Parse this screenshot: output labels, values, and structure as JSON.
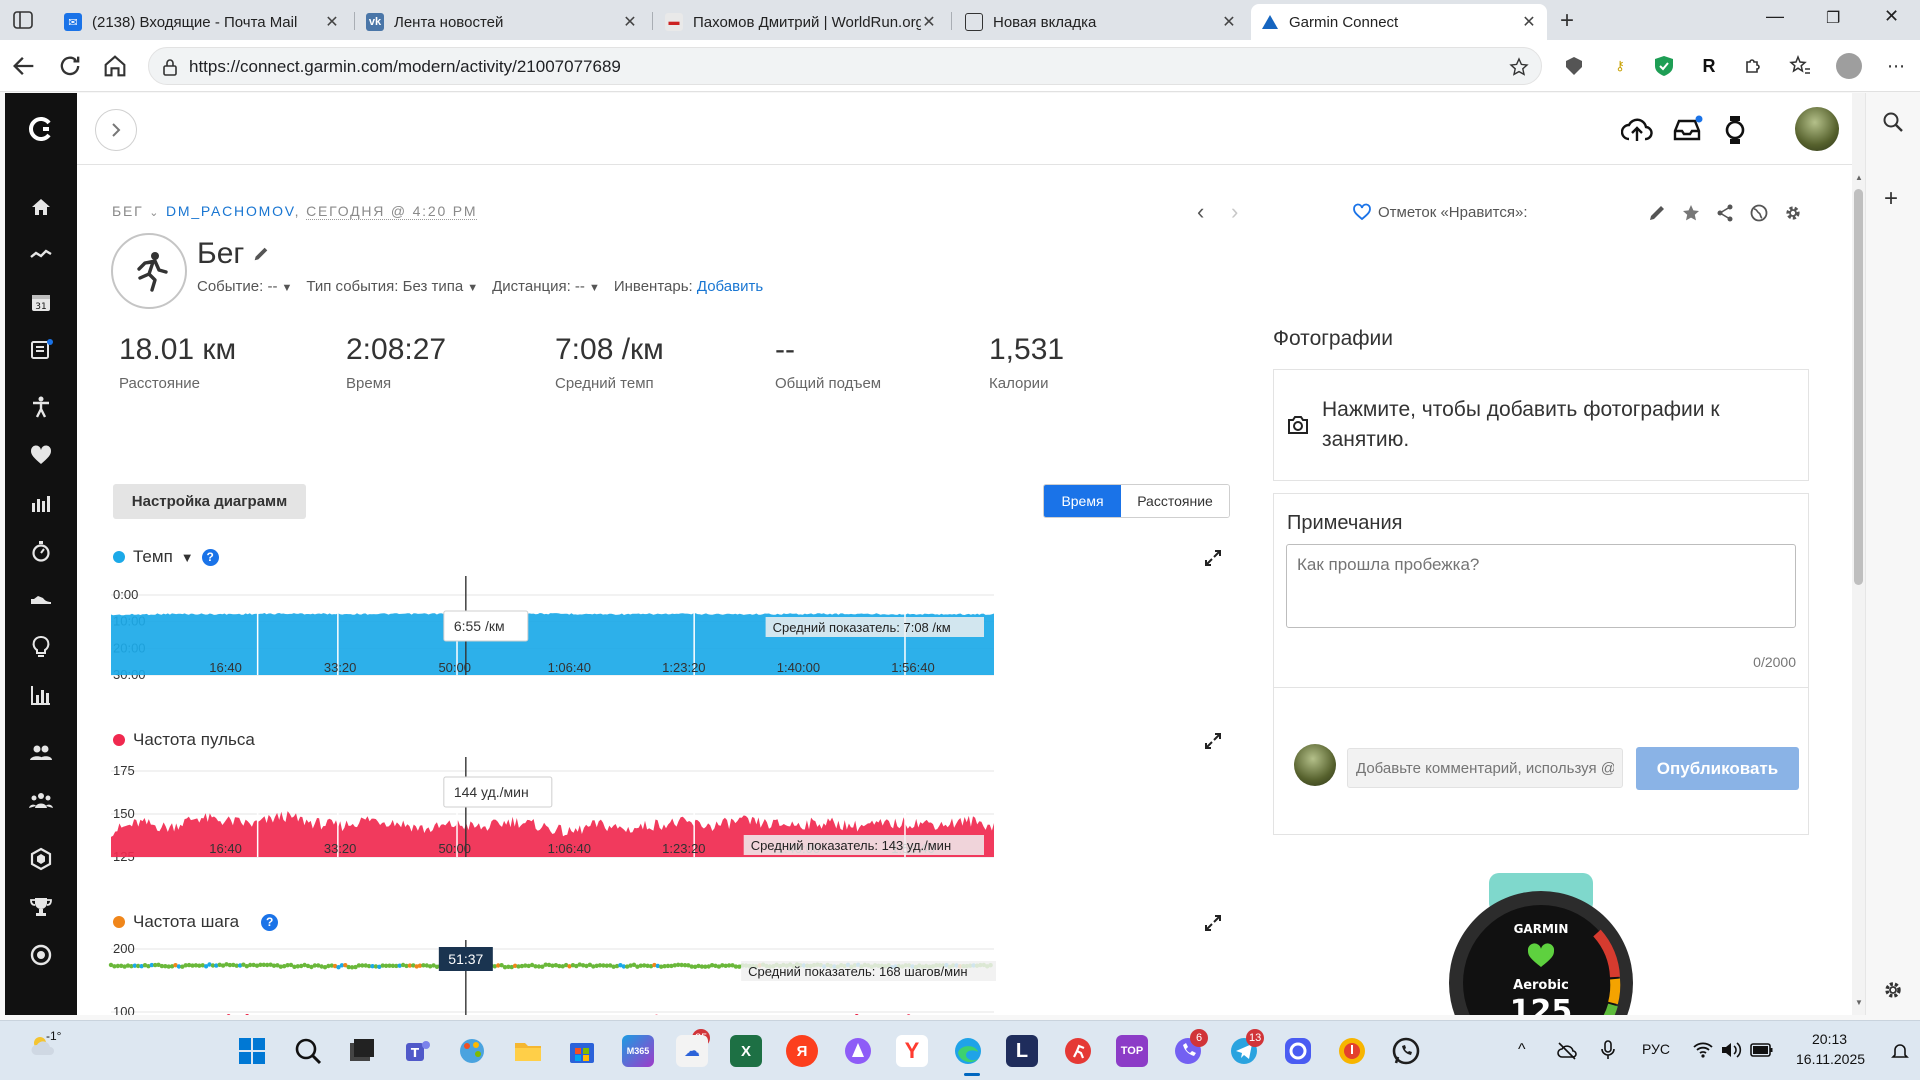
{
  "browser": {
    "tabs": [
      {
        "title": "(2138) Входящие - Почта Mail",
        "active": false
      },
      {
        "title": "Лента новостей",
        "active": false
      },
      {
        "title": "Пахомов Дмитрий | WorldRun.org",
        "active": false
      },
      {
        "title": "Новая вкладка",
        "active": false
      },
      {
        "title": "Garmin Connect",
        "active": true
      }
    ],
    "url": "https://connect.garmin.com/modern/activity/21007077689"
  },
  "activity": {
    "breadcrumb": {
      "sport": "БЕГ",
      "user": "DM_PACHOMOV",
      "date": "СЕГОДНЯ @ 4:20 PM"
    },
    "title": "Бег",
    "meta": {
      "event": "Событие: --",
      "event_type": "Тип события: Без типа",
      "distance": "Дистанция: --",
      "inventory_label": "Инвентарь:",
      "inventory_link": "Добавить"
    },
    "likes": "Отметок «Нравится»:",
    "stats": [
      {
        "value": "18.01 км",
        "label": "Расстояние"
      },
      {
        "value": "2:08:27",
        "label": "Время"
      },
      {
        "value": "7:08 /км",
        "label": "Средний темп"
      },
      {
        "value": "--",
        "label": "Общий подъем"
      },
      {
        "value": "1,531",
        "label": "Калории"
      }
    ],
    "chart_settings": "Настройка диаграмм",
    "toggle": {
      "time": "Время",
      "distance": "Расстояние"
    }
  },
  "chart_data": [
    {
      "type": "area",
      "title": "Темп",
      "color": "#1ba9e8",
      "x_ticks": [
        "16:40",
        "33:20",
        "50:00",
        "1:06:40",
        "1:23:20",
        "1:40:00",
        "1:56:40"
      ],
      "x_tick_seconds": [
        1000,
        2000,
        3000,
        4000,
        5000,
        6000,
        7000
      ],
      "x_range": [
        0,
        7707
      ],
      "y_ticks": [
        "0:00",
        "10:00",
        "20:00",
        "30:00"
      ],
      "ylim": [
        0,
        30
      ],
      "y_inverted": true,
      "avg_label": "Средний показатель: 7:08 /км",
      "cursor": {
        "x": 3097,
        "label": "6:55 /км"
      },
      "x": [
        0,
        500,
        1000,
        1500,
        2000,
        2500,
        3000,
        3500,
        4000,
        4500,
        5000,
        5500,
        6000,
        6500,
        7000,
        7707
      ],
      "values": [
        7.5,
        7.1,
        7.2,
        7.0,
        7.1,
        7.1,
        7.0,
        6.9,
        7.1,
        7.2,
        7.1,
        7.2,
        7.1,
        7.1,
        7.2,
        7.2
      ]
    },
    {
      "type": "area",
      "title": "Частота пульса",
      "color": "#f0294f",
      "x_ticks": [
        "16:40",
        "33:20",
        "50:00",
        "1:06:40",
        "1:23:20",
        "1:40:00",
        "1:56:40"
      ],
      "x_tick_seconds": [
        1000,
        2000,
        3000,
        4000,
        5000,
        6000,
        7000
      ],
      "x_range": [
        0,
        7707
      ],
      "y_ticks": [
        "175",
        "150",
        "125"
      ],
      "ylim": [
        125,
        175
      ],
      "avg_label": "Средний показатель: 143 уд./мин",
      "cursor": {
        "x": 3097,
        "label": "144 уд./мин"
      },
      "x": [
        0,
        250,
        500,
        750,
        1000,
        1250,
        1500,
        1750,
        2000,
        2250,
        2500,
        2750,
        3000,
        3250,
        3500,
        3750,
        4000,
        4250,
        4500,
        4750,
        5000,
        5250,
        5500,
        5750,
        6000,
        6250,
        6500,
        6750,
        7000,
        7250,
        7500,
        7707
      ],
      "values": [
        140,
        145,
        142,
        148,
        146,
        144,
        149,
        145,
        143,
        147,
        145,
        141,
        144,
        142,
        146,
        143,
        139,
        144,
        141,
        144,
        145,
        143,
        146,
        144,
        144,
        145,
        143,
        144,
        145,
        144,
        146,
        143
      ]
    },
    {
      "type": "scatter",
      "title": "Частота шага",
      "color": "#f0861a",
      "x_range": [
        0,
        7707
      ],
      "y_ticks": [
        "200",
        "100"
      ],
      "ylim": [
        80,
        200
      ],
      "avg_label": "Средний показатель: 168 шагов/мин",
      "cursor": {
        "x": 3097,
        "label": "51:37"
      },
      "x": [
        0,
        500,
        1000,
        1500,
        2000,
        2500,
        3000,
        3500,
        4000,
        4500,
        5000,
        5500,
        6000,
        6500,
        7000,
        7707
      ],
      "values": [
        168,
        168,
        169,
        168,
        167,
        168,
        168,
        167,
        169,
        168,
        168,
        168,
        169,
        168,
        167,
        168
      ]
    }
  ],
  "right": {
    "photos_title": "Фотографии",
    "photos_prompt": "Нажмите, чтобы добавить фотографии к занятию.",
    "notes_title": "Примечания",
    "notes_placeholder": "Как прошла пробежка?",
    "notes_count": "0/2000",
    "comment_placeholder": "Добавьте комментарий, используя @",
    "publish": "Опубликовать",
    "watch": {
      "brand": "GARMIN",
      "mode": "Aerobic",
      "value": "125"
    }
  },
  "taskbar": {
    "weather": "-1°",
    "lang": "РУС",
    "time": "20:13",
    "date": "16.11.2025",
    "badges": {
      "store": "25",
      "viber": "6",
      "telegram": "13"
    },
    "apps": [
      {
        "name": "m365",
        "text": "M365",
        "color": "#2b7cd3"
      },
      {
        "name": "excel",
        "text": "X",
        "color": "#1d7044"
      },
      {
        "name": "yandex",
        "text": "Я",
        "color": "#fc3f1d"
      },
      {
        "name": "yandex-browser",
        "text": "Y",
        "color": "#ff3b30"
      },
      {
        "name": "l-app",
        "text": "L",
        "color": "#1f2d5c"
      },
      {
        "name": "top-app",
        "text": "TOP",
        "color": "#8c3cc7"
      }
    ]
  }
}
